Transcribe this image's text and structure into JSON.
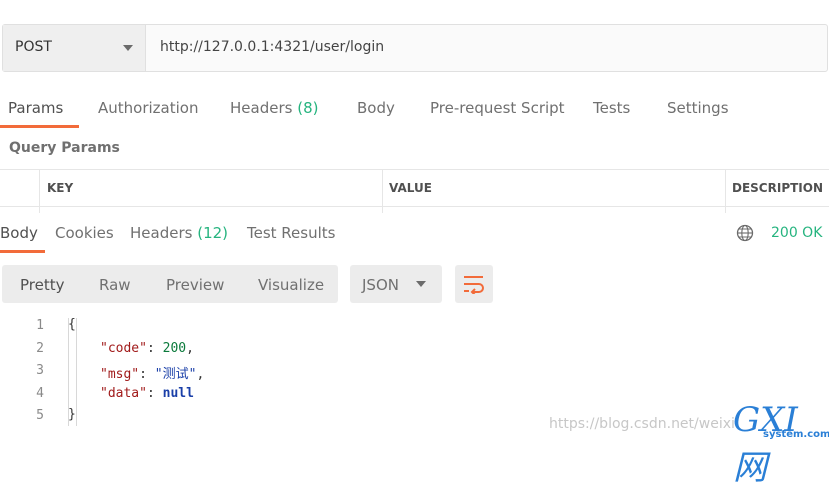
{
  "request": {
    "method": "POST",
    "url": "http://127.0.0.1:4321/user/login"
  },
  "request_tabs": [
    {
      "label": "Params",
      "count": ""
    },
    {
      "label": "Authorization",
      "count": ""
    },
    {
      "label": "Headers",
      "count": "(8)"
    },
    {
      "label": "Body",
      "count": ""
    },
    {
      "label": "Pre-request Script",
      "count": ""
    },
    {
      "label": "Tests",
      "count": ""
    },
    {
      "label": "Settings",
      "count": ""
    }
  ],
  "query_params": {
    "title": "Query Params",
    "columns": [
      "KEY",
      "VALUE",
      "DESCRIPTION"
    ]
  },
  "response_tabs": [
    {
      "label": "Body",
      "count": ""
    },
    {
      "label": "Cookies",
      "count": ""
    },
    {
      "label": "Headers",
      "count": "(12)"
    },
    {
      "label": "Test Results",
      "count": ""
    }
  ],
  "response_status": "200 OK",
  "view_modes": [
    "Pretty",
    "Raw",
    "Preview",
    "Visualize"
  ],
  "format": "JSON",
  "code": {
    "line_numbers": [
      "1",
      "2",
      "3",
      "4",
      "5"
    ],
    "open_brace": "{",
    "close_brace": "}",
    "code_key": "\"code\"",
    "code_value": "200",
    "msg_key": "\"msg\"",
    "msg_value": "\"测试\"",
    "data_key": "\"data\"",
    "data_value": "null"
  },
  "watermark": "https://blog.csdn.net/weixi",
  "logo_text": "GXI网",
  "logo_sub": "system.com",
  "colors": {
    "accent": "#f26b3a",
    "success": "#26b47f"
  }
}
